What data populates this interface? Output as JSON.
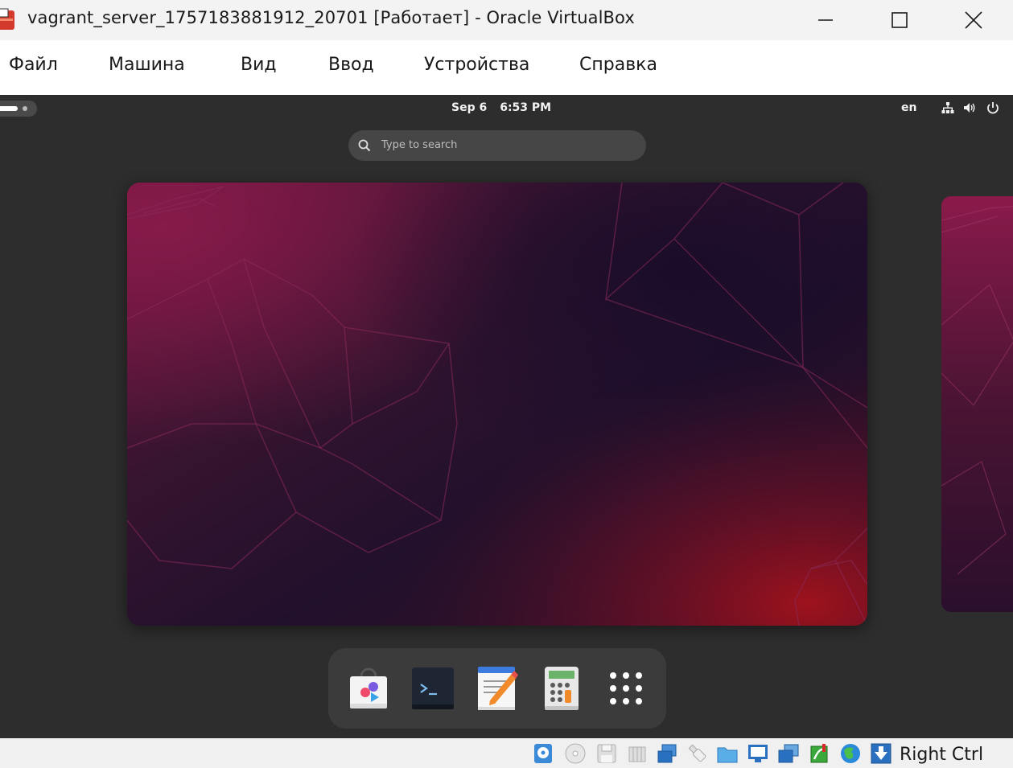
{
  "window": {
    "title": "vagrant_server_1757183881912_20701 [Работает] - Oracle VirtualBox",
    "controls": [
      "minimize-icon",
      "maximize-icon",
      "close-icon"
    ]
  },
  "menu": {
    "items": [
      "Файл",
      "Машина",
      "Вид",
      "Ввод",
      "Устройства",
      "Справка"
    ]
  },
  "guest": {
    "topbar": {
      "date": "Sep 6",
      "time": "6:53 PM",
      "language": "en",
      "tray_icons": [
        "network-icon",
        "volume-icon",
        "power-icon"
      ]
    },
    "search": {
      "placeholder": "Type to search"
    },
    "dock": {
      "apps": [
        "software-store-icon",
        "terminal-icon",
        "text-editor-icon",
        "calculator-icon",
        "app-grid-icon"
      ]
    }
  },
  "statusbar": {
    "icons": [
      "hard-disk-icon",
      "optical-drive-icon",
      "floppy-icon",
      "audio-icon",
      "network-adapters-icon",
      "usb-icon",
      "shared-folders-icon",
      "display-icon",
      "recording-icon",
      "cpu-execution-icon",
      "guest-additions-icon",
      "mouse-integration-icon"
    ],
    "host_key": "Right Ctrl"
  },
  "colors": {
    "guest_background": "#2d2d2d",
    "dock_background": "#3b3b3b",
    "wallpaper_accent": "#8a1a4a"
  }
}
